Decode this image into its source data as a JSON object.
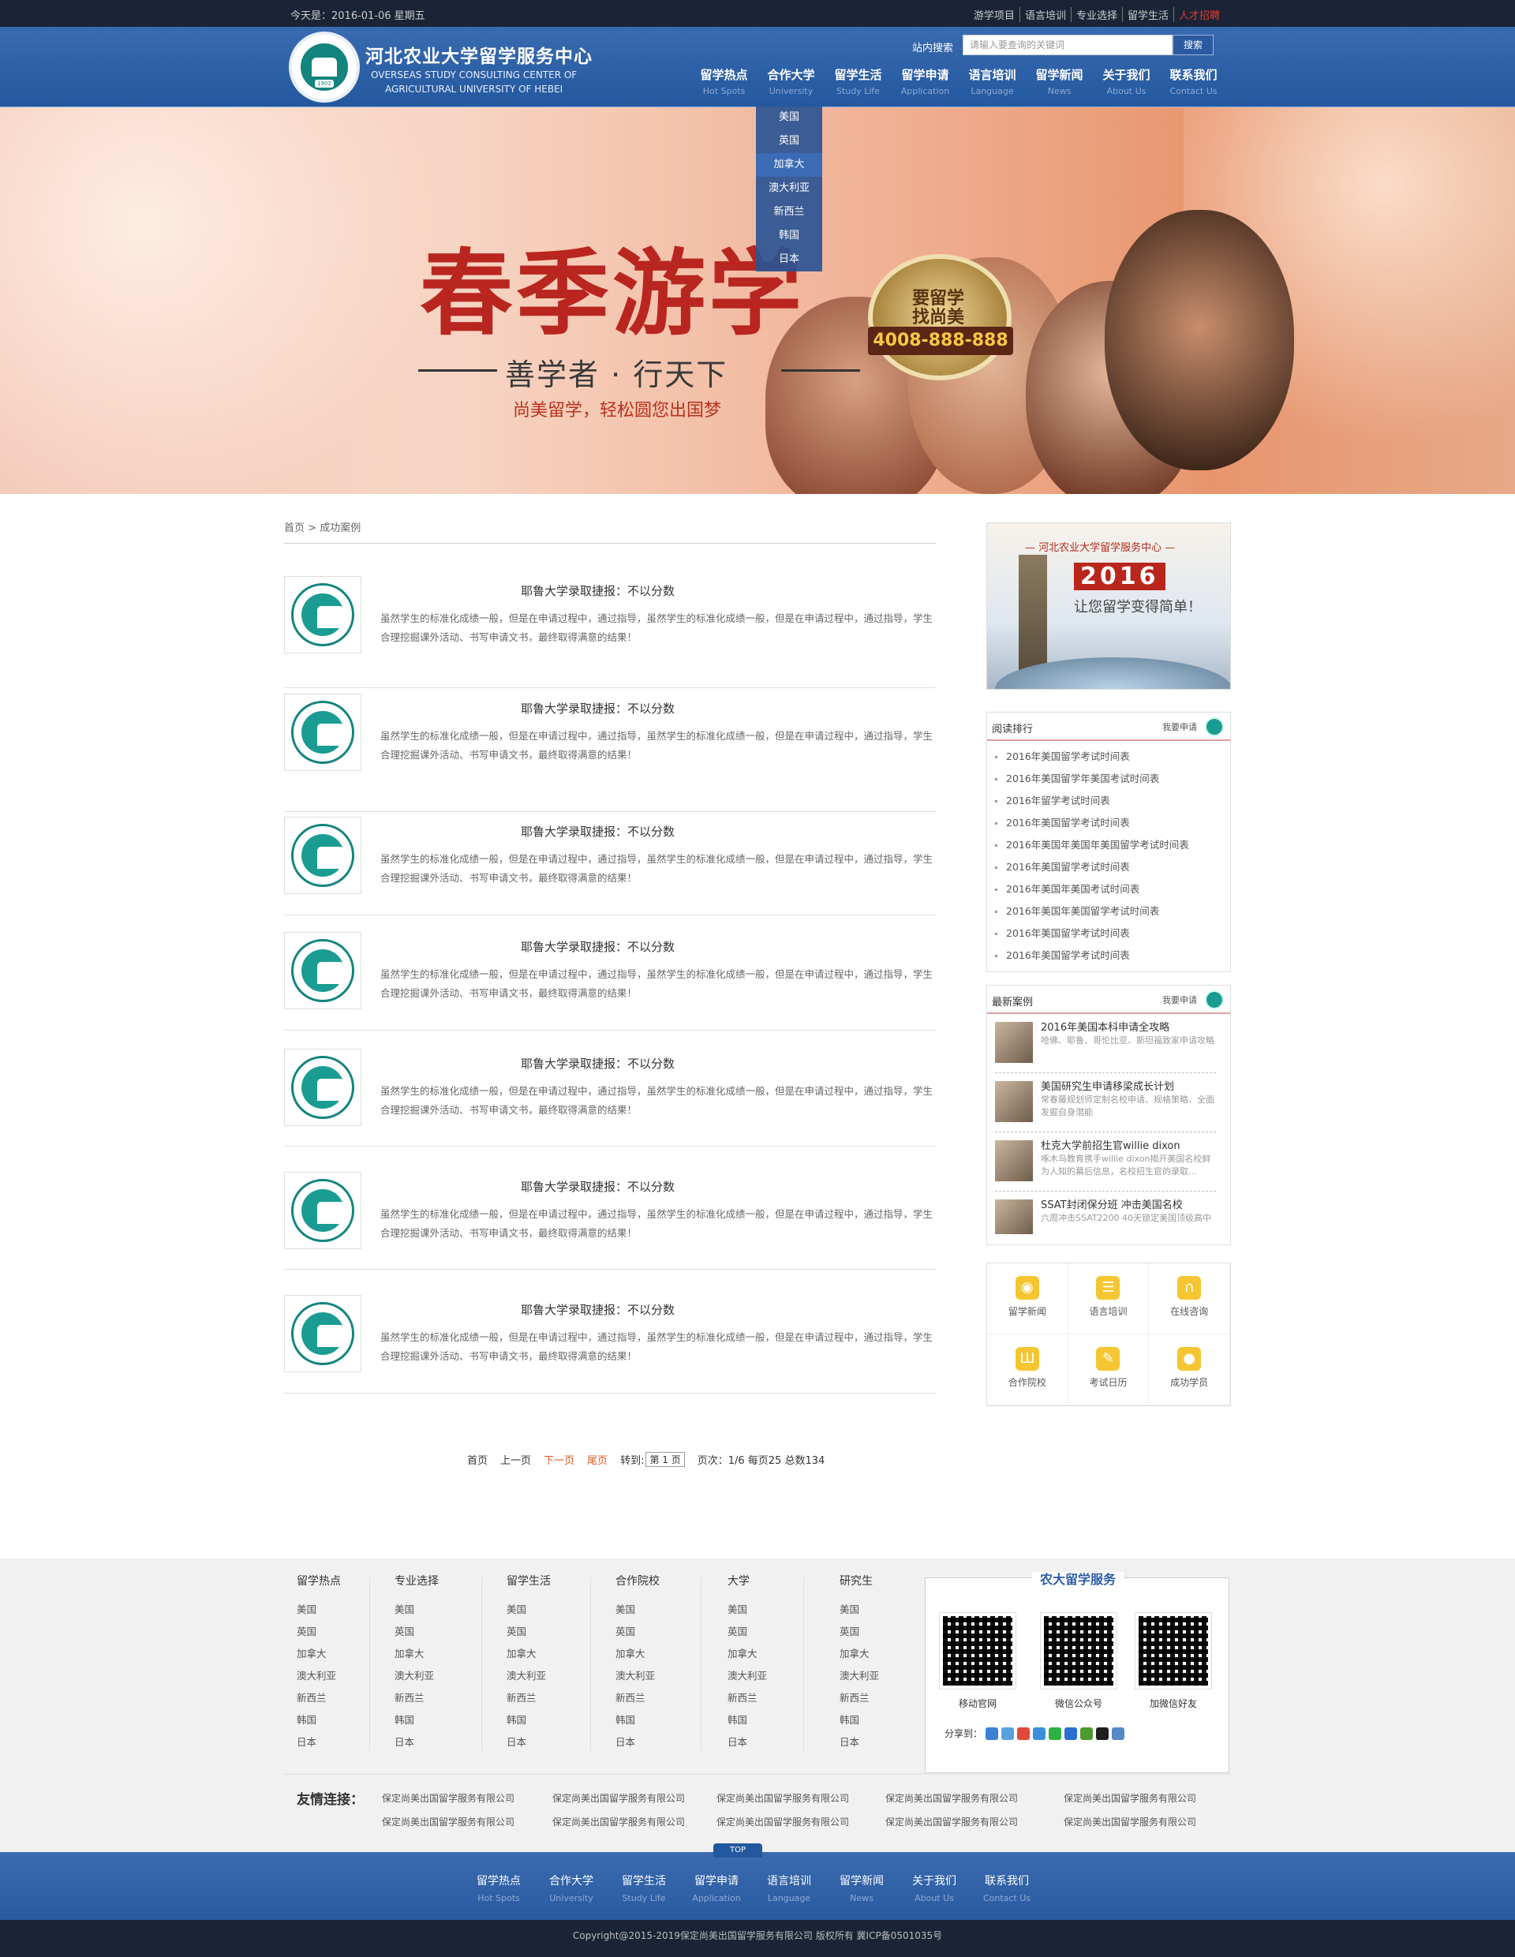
{
  "topbar": {
    "date": "今天是：2016-01-06   星期五",
    "links": [
      "游学项目",
      "语言培训",
      "专业选择",
      "留学生活",
      "人才招聘"
    ]
  },
  "header": {
    "title": "河北农业大学留学服务中心",
    "subtitle_line1": "OVERSEAS STUDY CONSULTING CENTER OF",
    "subtitle_line2": "AGRICULTURAL UNIVERSITY OF HEBEI",
    "search_label": "站内搜索",
    "search_placeholder": "请输入要查询的关键词",
    "search_button": "搜索"
  },
  "nav": [
    {
      "cn": "留学热点",
      "en": "Hot Spots"
    },
    {
      "cn": "合作大学",
      "en": "University"
    },
    {
      "cn": "留学生活",
      "en": "Study Life"
    },
    {
      "cn": "留学申请",
      "en": "Application"
    },
    {
      "cn": "语言培训",
      "en": "Language"
    },
    {
      "cn": "留学新闻",
      "en": "News"
    },
    {
      "cn": "关于我们",
      "en": "About Us"
    },
    {
      "cn": "联系我们",
      "en": "Contact Us"
    }
  ],
  "dropdown": [
    "美国",
    "英国",
    "加拿大",
    "澳大利亚",
    "新西兰",
    "韩国",
    "日本"
  ],
  "banner": {
    "title": "春季游学",
    "subtitle": "善学者 · 行天下",
    "tagline": "尚美留学，轻松圆您出国梦",
    "badge_line1": "要留学",
    "badge_line2": "找尚美",
    "badge_phone": "4008-888-888"
  },
  "breadcrumb": {
    "home": "首页",
    "sep": ">",
    "current": "成功案例"
  },
  "articles": [
    {
      "title": "耶鲁大学录取捷报：不以分数",
      "desc": "虽然学生的标准化成绩一般，但是在申请过程中，通过指导，虽然学生的标准化成绩一般，但是在申请过程中，通过指导，学生合理挖掘课外活动、书写申请文书，最终取得满意的结果！"
    },
    {
      "title": "耶鲁大学录取捷报：不以分数",
      "desc": "虽然学生的标准化成绩一般，但是在申请过程中，通过指导，虽然学生的标准化成绩一般，但是在申请过程中，通过指导，学生合理挖掘课外活动、书写申请文书，最终取得满意的结果！"
    },
    {
      "title": "耶鲁大学录取捷报：不以分数",
      "desc": "虽然学生的标准化成绩一般，但是在申请过程中，通过指导，虽然学生的标准化成绩一般，但是在申请过程中，通过指导，学生合理挖掘课外活动、书写申请文书，最终取得满意的结果！"
    },
    {
      "title": "耶鲁大学录取捷报：不以分数",
      "desc": "虽然学生的标准化成绩一般，但是在申请过程中，通过指导，虽然学生的标准化成绩一般，但是在申请过程中，通过指导，学生合理挖掘课外活动、书写申请文书，最终取得满意的结果！"
    },
    {
      "title": "耶鲁大学录取捷报：不以分数",
      "desc": "虽然学生的标准化成绩一般，但是在申请过程中，通过指导，虽然学生的标准化成绩一般，但是在申请过程中，通过指导，学生合理挖掘课外活动、书写申请文书，最终取得满意的结果！"
    },
    {
      "title": "耶鲁大学录取捷报：不以分数",
      "desc": "虽然学生的标准化成绩一般，但是在申请过程中，通过指导，虽然学生的标准化成绩一般，但是在申请过程中，通过指导，学生合理挖掘课外活动、书写申请文书，最终取得满意的结果！"
    },
    {
      "title": "耶鲁大学录取捷报：不以分数",
      "desc": "虽然学生的标准化成绩一般，但是在申请过程中，通过指导，虽然学生的标准化成绩一般，但是在申请过程中，通过指导，学生合理挖掘课外活动、书写申请文书，最终取得满意的结果！"
    }
  ],
  "pager": {
    "first": "首页",
    "prev": "上一页",
    "next": "下一页",
    "last": "尾页",
    "goto": "转到:",
    "page_select": "第 1 页",
    "summary": "页次：1/6 每页25 总数134"
  },
  "promo": {
    "header": "— 河北农业大学留学服务中心 —",
    "year": "2016",
    "slogan": "让您留学变得简单！"
  },
  "rank": {
    "title": "阅读排行",
    "more": "我要申请",
    "items": [
      "2016年美国留学考试时间表",
      "2016年美国留学年美国考试时间表",
      "2016年留学考试时间表",
      "2016年美国留学考试时间表",
      "2016年美国年美国年美国留学考试时间表",
      "2016年美国留学考试时间表",
      "2016年美国年美国考试时间表",
      "2016年美国年美国留学考试时间表",
      "2016年美国留学考试时间表",
      "2016年美国留学考试时间表"
    ]
  },
  "cases": {
    "title": "最新案例",
    "more": "我要申请",
    "items": [
      {
        "title": "2016年美国本科申请全攻略",
        "desc": "哈佛、耶鲁、哥伦比亚、斯坦福致家申请攻略"
      },
      {
        "title": "美国研究生申请移梁成长计划",
        "desc": "常春藤规划师定制名校申请、规格策略、全面发掘自身潜能"
      },
      {
        "title": "杜克大学前招生官willie dixon",
        "desc": "啄木鸟教育携手willie dixon揭开美国名校鲜为人知的幕后信息，名校招生官的录取..."
      },
      {
        "title": "SSAT封闭保分班 冲击美国名校",
        "desc": "六周冲击SSAT2200 40天锁定美国顶级高中"
      }
    ]
  },
  "quick_links": [
    {
      "label": "留学新闻",
      "icon": "globe-icon"
    },
    {
      "label": "语言培训",
      "icon": "notebook-icon"
    },
    {
      "label": "在线咨询",
      "icon": "headphones-icon"
    },
    {
      "label": "合作院校",
      "icon": "bank-icon"
    },
    {
      "label": "考试日历",
      "icon": "calendar-edit-icon"
    },
    {
      "label": "成功学员",
      "icon": "group-icon"
    }
  ],
  "footer": {
    "columns": [
      {
        "title": "留学热点",
        "items": [
          "美国",
          "英国",
          "加拿大",
          "澳大利亚",
          "新西兰",
          "韩国",
          "日本"
        ]
      },
      {
        "title": "专业选择",
        "items": [
          "美国",
          "英国",
          "加拿大",
          "澳大利亚",
          "新西兰",
          "韩国",
          "日本"
        ]
      },
      {
        "title": "留学生活",
        "items": [
          "美国",
          "英国",
          "加拿大",
          "澳大利亚",
          "新西兰",
          "韩国",
          "日本"
        ]
      },
      {
        "title": "合作院校",
        "items": [
          "美国",
          "英国",
          "加拿大",
          "澳大利亚",
          "新西兰",
          "韩国",
          "日本"
        ]
      },
      {
        "title": "大学",
        "items": [
          "美国",
          "英国",
          "加拿大",
          "澳大利亚",
          "新西兰",
          "韩国",
          "日本"
        ]
      },
      {
        "title": "研究生",
        "items": [
          "美国",
          "英国",
          "加拿大",
          "澳大利亚",
          "新西兰",
          "韩国",
          "日本"
        ]
      }
    ],
    "qr_title": "农大留学服务",
    "qr_labels": [
      "移动官网",
      "微信公众号",
      "加微信好友"
    ],
    "share_label": "分享到：",
    "friend_label": "友情连接：",
    "friend_links": [
      "保定尚美出国留学服务有限公司",
      "保定尚美出国留学服务有限公司",
      "保定尚美出国留学服务有限公司",
      "保定尚美出国留学服务有限公司",
      "保定尚美出国留学服务有限公司",
      "保定尚美出国留学服务有限公司",
      "保定尚美出国留学服务有限公司",
      "保定尚美出国留学服务有限公司",
      "保定尚美出国留学服务有限公司",
      "保定尚美出国留学服务有限公司"
    ],
    "top_label": "TOP",
    "bottom_nav": [
      {
        "cn": "留学热点",
        "en": "Hot Spots"
      },
      {
        "cn": "合作大学",
        "en": "University"
      },
      {
        "cn": "留学生活",
        "en": "Study Life"
      },
      {
        "cn": "留学申请",
        "en": "Application"
      },
      {
        "cn": "语言培训",
        "en": "Language"
      },
      {
        "cn": "留学新闻",
        "en": "News"
      },
      {
        "cn": "关于我们",
        "en": "About Us"
      },
      {
        "cn": "联系我们",
        "en": "Contact Us"
      }
    ],
    "copyright": "Copyright@2015-2019保定尚美出国留学服务有限公司 版权所有 冀ICP备0501035号"
  }
}
